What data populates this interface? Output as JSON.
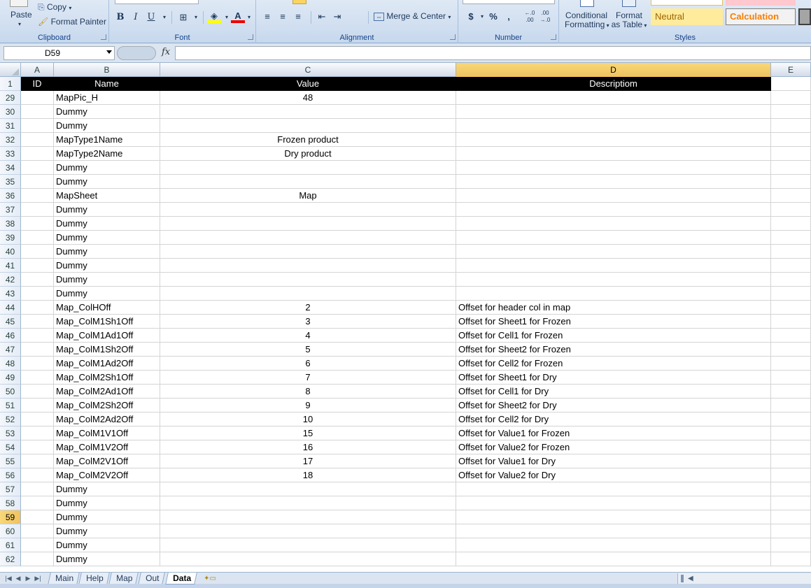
{
  "ribbon": {
    "clipboard": {
      "paste": "Paste",
      "copy": "Copy",
      "format_painter": "Format Painter",
      "label": "Clipboard"
    },
    "font": {
      "label": "Font",
      "bold": "B",
      "italic": "I",
      "underline": "U",
      "font_color_glyph": "A"
    },
    "alignment": {
      "label": "Alignment",
      "merge_center": "Merge & Center"
    },
    "number": {
      "label": "Number",
      "currency": "$",
      "percent": "%",
      "comma": ",",
      "inc_decimal": "+.0 .00",
      "dec_decimal": ".00 ->.0"
    },
    "styles": {
      "label": "Styles",
      "conditional_formatting_1": "Conditional",
      "conditional_formatting_2": "Formatting",
      "format_as_table_1": "Format",
      "format_as_table_2": "as Table",
      "neutral": "Neutral",
      "calculation": "Calculation",
      "neutral_color": "#ffeb9c",
      "calculation_color": "#fa7d00"
    }
  },
  "formula_bar": {
    "name_box": "D59",
    "fx": "fx",
    "formula": ""
  },
  "columns": [
    "A",
    "B",
    "C",
    "D",
    "E"
  ],
  "selected_column": "D",
  "header_row": {
    "num": "1",
    "A": "ID",
    "B": "Name",
    "C": "Value",
    "D": "Descriptiom"
  },
  "rows": [
    {
      "num": "29",
      "B": "MapPic_H",
      "C": "48",
      "D": ""
    },
    {
      "num": "30",
      "B": "Dummy",
      "C": "",
      "D": ""
    },
    {
      "num": "31",
      "B": "Dummy",
      "C": "",
      "D": ""
    },
    {
      "num": "32",
      "B": "MapType1Name",
      "C": "Frozen product",
      "D": ""
    },
    {
      "num": "33",
      "B": "MapType2Name",
      "C": "Dry product",
      "D": ""
    },
    {
      "num": "34",
      "B": "Dummy",
      "C": "",
      "D": ""
    },
    {
      "num": "35",
      "B": "Dummy",
      "C": "",
      "D": ""
    },
    {
      "num": "36",
      "B": "MapSheet",
      "C": "Map",
      "D": ""
    },
    {
      "num": "37",
      "B": "Dummy",
      "C": "",
      "D": ""
    },
    {
      "num": "38",
      "B": "Dummy",
      "C": "",
      "D": ""
    },
    {
      "num": "39",
      "B": "Dummy",
      "C": "",
      "D": ""
    },
    {
      "num": "40",
      "B": "Dummy",
      "C": "",
      "D": ""
    },
    {
      "num": "41",
      "B": "Dummy",
      "C": "",
      "D": ""
    },
    {
      "num": "42",
      "B": "Dummy",
      "C": "",
      "D": ""
    },
    {
      "num": "43",
      "B": "Dummy",
      "C": "",
      "D": ""
    },
    {
      "num": "44",
      "B": "Map_ColHOff",
      "C": "2",
      "D": "Offset for header col in map"
    },
    {
      "num": "45",
      "B": "Map_ColM1Sh1Off",
      "C": "3",
      "D": "Offset for Sheet1 for Frozen"
    },
    {
      "num": "46",
      "B": "Map_ColM1Ad1Off",
      "C": "4",
      "D": "Offset for Cell1 for Frozen"
    },
    {
      "num": "47",
      "B": "Map_ColM1Sh2Off",
      "C": "5",
      "D": "Offset for Sheet2 for Frozen"
    },
    {
      "num": "48",
      "B": "Map_ColM1Ad2Off",
      "C": "6",
      "D": "Offset for Cell2 for Frozen"
    },
    {
      "num": "49",
      "B": "Map_ColM2Sh1Off",
      "C": "7",
      "D": "Offset for Sheet1 for Dry"
    },
    {
      "num": "50",
      "B": "Map_ColM2Ad1Off",
      "C": "8",
      "D": "Offset for Cell1 for Dry"
    },
    {
      "num": "51",
      "B": "Map_ColM2Sh2Off",
      "C": "9",
      "D": "Offset for Sheet2 for Dry"
    },
    {
      "num": "52",
      "B": "Map_ColM2Ad2Off",
      "C": "10",
      "D": "Offset for Cell2 for Dry"
    },
    {
      "num": "53",
      "B": "Map_ColM1V1Off",
      "C": "15",
      "D": "Offset for Value1 for Frozen"
    },
    {
      "num": "54",
      "B": "Map_ColM1V2Off",
      "C": "16",
      "D": "Offset for Value2 for Frozen"
    },
    {
      "num": "55",
      "B": "Map_ColM2V1Off",
      "C": "17",
      "D": "Offset for Value1 for Dry"
    },
    {
      "num": "56",
      "B": "Map_ColM2V2Off",
      "C": "18",
      "D": "Offset for Value2 for Dry"
    },
    {
      "num": "57",
      "B": "Dummy",
      "C": "",
      "D": ""
    },
    {
      "num": "58",
      "B": "Dummy",
      "C": "",
      "D": ""
    },
    {
      "num": "59",
      "B": "Dummy",
      "C": "",
      "D": ""
    },
    {
      "num": "60",
      "B": "Dummy",
      "C": "",
      "D": ""
    },
    {
      "num": "61",
      "B": "Dummy",
      "C": "",
      "D": ""
    },
    {
      "num": "62",
      "B": "Dummy",
      "C": "",
      "D": ""
    }
  ],
  "active_row": "59",
  "sheet_tabs": [
    "Main",
    "Help",
    "Map",
    "Out",
    "Data"
  ],
  "active_tab": "Data"
}
